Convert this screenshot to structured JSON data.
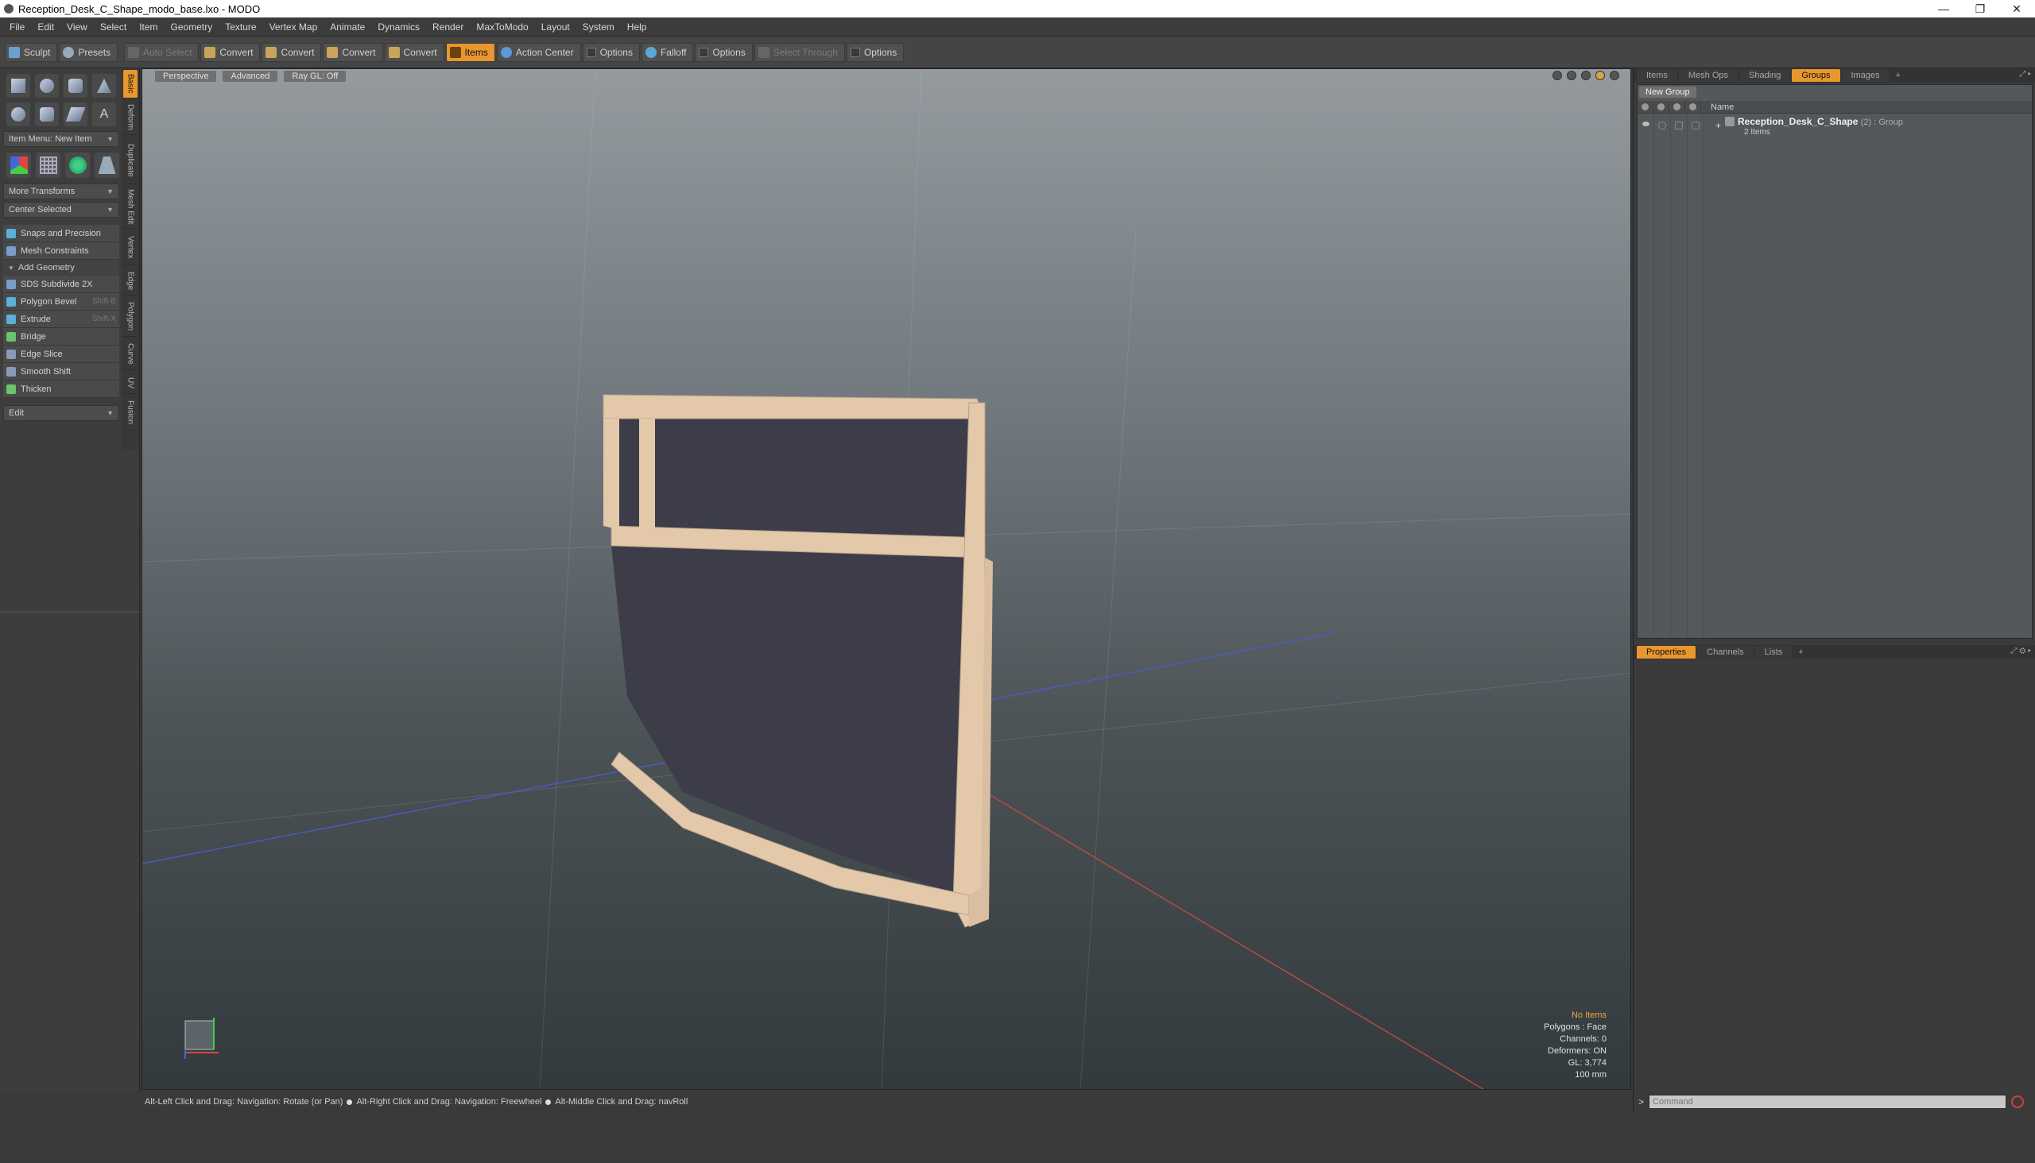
{
  "window": {
    "title": "Reception_Desk_C_Shape_modo_base.lxo - MODO",
    "controls": [
      "—",
      "❐",
      "✕"
    ]
  },
  "menu": [
    "File",
    "Edit",
    "View",
    "Select",
    "Item",
    "Geometry",
    "Texture",
    "Vertex Map",
    "Animate",
    "Dynamics",
    "Render",
    "MaxToModo",
    "Layout",
    "System",
    "Help"
  ],
  "toolbar": {
    "sculpt": "Sculpt",
    "presets": "Presets",
    "auto_select": "Auto Select",
    "convert1": "Convert",
    "convert2": "Convert",
    "convert3": "Convert",
    "convert4": "Convert",
    "items": "Items",
    "action_center": "Action Center",
    "options1": "Options",
    "falloff": "Falloff",
    "options2": "Options",
    "select_through": "Select Through",
    "options3": "Options"
  },
  "left": {
    "item_menu": "Item Menu: New Item",
    "more_transforms": "More Transforms",
    "center_selected": "Center Selected",
    "snaps": "Snaps and Precision",
    "mesh_constraints": "Mesh Constraints",
    "add_geometry": "Add Geometry",
    "tools": [
      {
        "label": "SDS Subdivide 2X",
        "shortcut": ""
      },
      {
        "label": "Polygon Bevel",
        "shortcut": "Shift-B"
      },
      {
        "label": "Extrude",
        "shortcut": "Shift-X"
      },
      {
        "label": "Bridge",
        "shortcut": ""
      },
      {
        "label": "Edge Slice",
        "shortcut": ""
      },
      {
        "label": "Smooth Shift",
        "shortcut": ""
      },
      {
        "label": "Thicken",
        "shortcut": ""
      }
    ],
    "edit": "Edit",
    "vtabs": [
      "Basic",
      "Deform",
      "Duplicate",
      "Mesh Edit",
      "Vertex",
      "Edge",
      "Polygon",
      "Curve",
      "UV",
      "Fusion"
    ]
  },
  "viewport": {
    "perspective": "Perspective",
    "advanced": "Advanced",
    "raygl": "Ray GL: Off",
    "info": {
      "no_items": "No Items",
      "polygons": "Polygons : Face",
      "channels": "Channels: 0",
      "deformers": "Deformers: ON",
      "gl": "GL: 3,774",
      "scale": "100 mm"
    },
    "colors": {
      "desk_frame": "#e3c8aa",
      "desk_panel": "#3c3d48",
      "accent": "#e8962e"
    }
  },
  "status": {
    "hint1": "Alt-Left Click and Drag: Navigation: Rotate (or Pan)",
    "hint2": "Alt-Right Click and Drag: Navigation: Freewheel",
    "hint3": "Alt-Middle Click and Drag: navRoll"
  },
  "right": {
    "tabs_top": [
      "Items",
      "Mesh Ops",
      "Shading",
      "Groups",
      "Images"
    ],
    "new_group": "New Group",
    "name_header": "Name",
    "group": {
      "name": "Reception_Desk_C_Shape",
      "meta": "(2) : Group",
      "sub": "2 Items"
    },
    "tabs_bottom": [
      "Properties",
      "Channels",
      "Lists"
    ],
    "command_placeholder": "Command"
  }
}
